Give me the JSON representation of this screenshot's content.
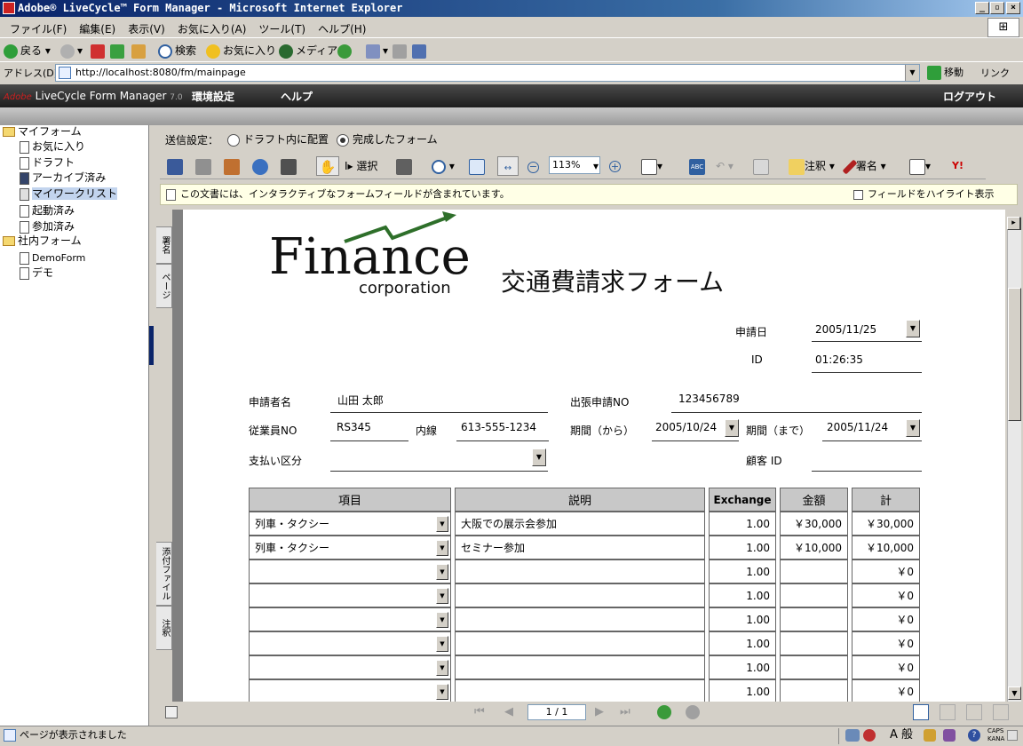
{
  "window": {
    "title": "Adobe® LiveCycle™ Form Manager - Microsoft Internet Explorer"
  },
  "menubar": {
    "items": [
      "ファイル(F)",
      "編集(E)",
      "表示(V)",
      "お気に入り(A)",
      "ツール(T)",
      "ヘルプ(H)"
    ]
  },
  "toolbar": {
    "back": "戻る",
    "search": "検索",
    "favorites": "お気に入り",
    "media": "メディア"
  },
  "address": {
    "label": "アドレス(D)",
    "url": "http://localhost:8080/fm/mainpage",
    "go": "移動",
    "links": "リンク"
  },
  "app": {
    "brand_adobe": "Adobe",
    "brand_name": "LiveCycle Form Manager",
    "version": "7.0",
    "nav_settings": "環境設定",
    "nav_help": "ヘルプ",
    "logout": "ログアウト"
  },
  "sidebar": {
    "my_forms": "マイフォーム",
    "items": [
      "お気に入り",
      "ドラフト",
      "アーカイブ済み",
      "マイワークリスト",
      "起動済み",
      "参加済み"
    ],
    "company_forms": "社内フォーム",
    "company_items": [
      "DemoForm",
      "デモ"
    ]
  },
  "send": {
    "label": "送信設定：",
    "option_draft": "ドラフト内に配置",
    "option_complete": "完成したフォーム"
  },
  "reader": {
    "select_label": "選択",
    "zoom": "113%",
    "comment": "注釈",
    "sign": "署名"
  },
  "notice": {
    "text": "この文書には、インタラクティブなフォームフィールドが含まれています。",
    "highlight": "フィールドをハイライト表示"
  },
  "vtabs": {
    "signatures": "署名",
    "pages": "ページ",
    "attachments": "添付ファイル",
    "comments": "注釈"
  },
  "form": {
    "logo_word": "Finance",
    "logo_sub": "corporation",
    "title": "交通費請求フォーム",
    "date_label": "申請日",
    "date_value": "2005/11/25",
    "id_label": "ID",
    "id_value": "01:26:35",
    "applicant_label": "申請者名",
    "applicant_value": "山田 太郎",
    "trip_label": "出張申請NO",
    "trip_value": "123456789",
    "employee_label": "従業員NO",
    "employee_value": "RS345",
    "ext_label": "内線",
    "ext_value": "613-555-1234",
    "period_from_label": "期間（から）",
    "period_from_value": "2005/10/24",
    "period_to_label": "期間（まで）",
    "period_to_value": "2005/11/24",
    "payment_label": "支払い区分",
    "customer_label": "顧客 ID",
    "headers": {
      "item": "項目",
      "desc": "説明",
      "exchange": "Exchange",
      "amount": "金額",
      "total": "計"
    },
    "rows": [
      {
        "item": "列車・タクシー",
        "desc": "大阪での展示会参加",
        "exchange": "1.00",
        "amount": "￥30,000",
        "total": "￥30,000"
      },
      {
        "item": "列車・タクシー",
        "desc": "セミナー参加",
        "exchange": "1.00",
        "amount": "￥10,000",
        "total": "￥10,000"
      },
      {
        "item": "",
        "desc": "",
        "exchange": "1.00",
        "amount": "",
        "total": "￥0"
      },
      {
        "item": "",
        "desc": "",
        "exchange": "1.00",
        "amount": "",
        "total": "￥0"
      },
      {
        "item": "",
        "desc": "",
        "exchange": "1.00",
        "amount": "",
        "total": "￥0"
      },
      {
        "item": "",
        "desc": "",
        "exchange": "1.00",
        "amount": "",
        "total": "￥0"
      },
      {
        "item": "",
        "desc": "",
        "exchange": "1.00",
        "amount": "",
        "total": "￥0"
      },
      {
        "item": "",
        "desc": "",
        "exchange": "1.00",
        "amount": "",
        "total": "￥0"
      }
    ]
  },
  "pagenav": {
    "page": "1 / 1"
  },
  "status": {
    "text": "ページが表示されました",
    "ime": "A 般",
    "caps": "CAPS",
    "kana": "KANA"
  }
}
